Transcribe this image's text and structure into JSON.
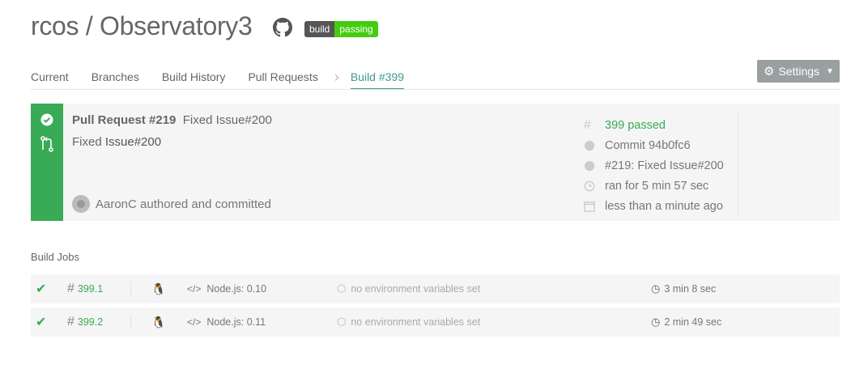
{
  "repo": {
    "title": "rcos / Observatory3"
  },
  "badge": {
    "left": "build",
    "right": "passing"
  },
  "tabs": [
    "Current",
    "Branches",
    "Build History",
    "Pull Requests",
    "Build #399"
  ],
  "settings": {
    "label": "Settings"
  },
  "build": {
    "pr_label": "Pull Request #219",
    "pr_title": "Fixed Issue#200",
    "commit_prefix": "Fixed ",
    "commit_hl": "Issue#200",
    "author": "AaronC authored and committed",
    "status": "399 passed",
    "commit": "Commit 94b0fc6",
    "pr_ref": "#219: Fixed Issue#200",
    "duration": "ran for 5 min 57 sec",
    "finished": "less than a minute ago"
  },
  "jobs": {
    "heading": "Build Jobs",
    "rows": [
      {
        "number": "399.1",
        "lang": "Node.js: 0.10",
        "env": "no environment variables set",
        "duration": "3 min 8 sec"
      },
      {
        "number": "399.2",
        "lang": "Node.js: 0.11",
        "env": "no environment variables set",
        "duration": "2 min 49 sec"
      }
    ]
  },
  "colors": {
    "passed": "#39aa56",
    "active_tab": "#3f9a8e",
    "settings_bg": "#9aa0a0"
  }
}
